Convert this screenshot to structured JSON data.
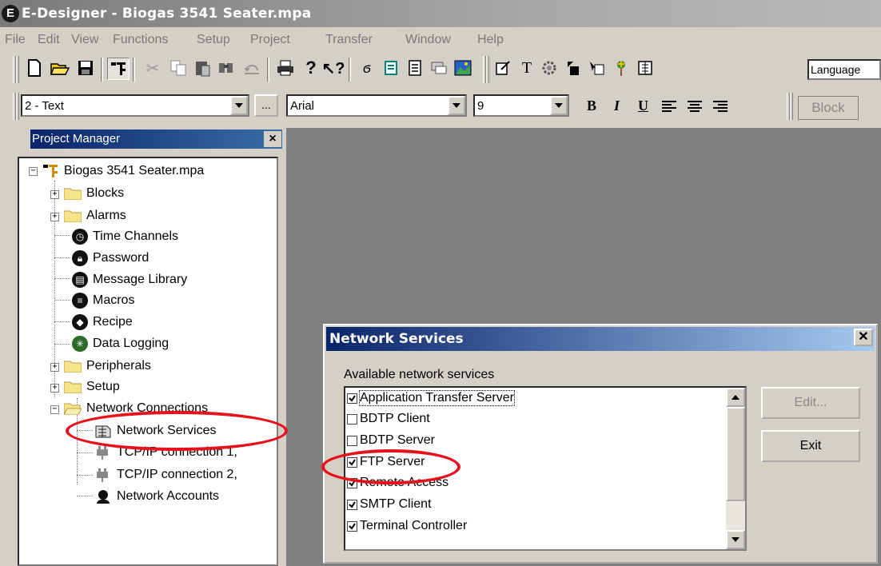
{
  "window": {
    "title": "E-Designer - Biogas 3541 Seater.mpa",
    "app_icon_letter": "E"
  },
  "menu": [
    "File",
    "Edit",
    "View",
    "Functions",
    "Setup",
    "Project",
    "Transfer",
    "Window",
    "Help"
  ],
  "toolbar": {
    "language_box": "Language",
    "object_combo": "2 - Text",
    "ellipsis": "...",
    "font_combo": "Arial",
    "size_combo": "9",
    "bold": "B",
    "italic": "I",
    "underline": "U",
    "block_button": "Block"
  },
  "project_manager": {
    "title": "Project Manager",
    "close": "×",
    "root": "Biogas 3541 Seater.mpa",
    "items": [
      {
        "label": "Blocks"
      },
      {
        "label": "Alarms"
      },
      {
        "label": "Time Channels"
      },
      {
        "label": "Password"
      },
      {
        "label": "Message Library"
      },
      {
        "label": "Macros"
      },
      {
        "label": "Recipe"
      },
      {
        "label": "Data Logging"
      },
      {
        "label": "Peripherals"
      },
      {
        "label": "Setup"
      },
      {
        "label": "Network Connections"
      },
      {
        "label": "Network Services"
      },
      {
        "label": "TCP/IP connection 1,"
      },
      {
        "label": "TCP/IP connection 2,"
      },
      {
        "label": "Network Accounts"
      }
    ]
  },
  "dialog": {
    "title": "Network Services",
    "close": "✕",
    "list_label": "Available network services",
    "services": [
      {
        "label": "Application Transfer Server",
        "checked": true
      },
      {
        "label": "BDTP Client",
        "checked": false
      },
      {
        "label": "BDTP Server",
        "checked": false
      },
      {
        "label": "FTP Server",
        "checked": true
      },
      {
        "label": "Remote Access",
        "checked": true
      },
      {
        "label": "SMTP Client",
        "checked": true
      },
      {
        "label": "Terminal Controller",
        "checked": true
      }
    ],
    "edit_button": "Edit...",
    "exit_button": "Exit"
  },
  "colors": {
    "annotation": "#e8111b",
    "title_bar": "#0a246a"
  }
}
